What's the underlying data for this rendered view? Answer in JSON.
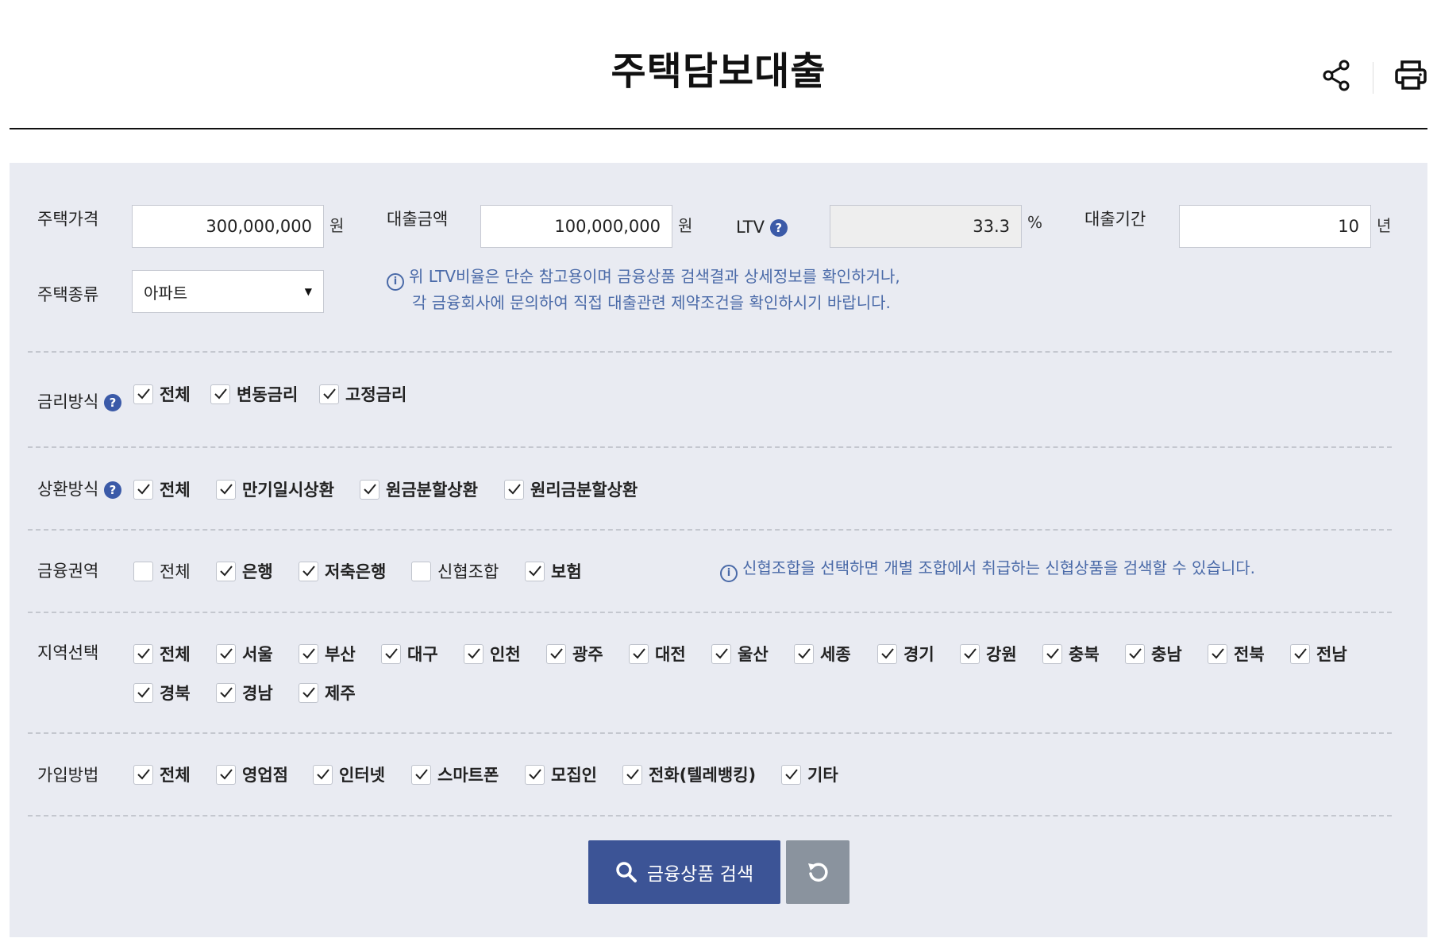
{
  "title": "주택담보대출",
  "inputs": {
    "house_price": {
      "label": "주택가격",
      "value": "300,000,000",
      "unit": "원"
    },
    "loan_amount": {
      "label": "대출금액",
      "value": "100,000,000",
      "unit": "원"
    },
    "ltv": {
      "label": "LTV",
      "value": "33.3",
      "unit": "%"
    },
    "loan_period": {
      "label": "대출기간",
      "value": "10",
      "unit": "년"
    },
    "house_type": {
      "label": "주택종류",
      "value": "아파트"
    }
  },
  "ltv_note": {
    "line1": "위 LTV비율은 단순 참고용이며 금융상품 검색결과 상세정보를 확인하거나,",
    "line2": "각 금융회사에 문의하여 직접 대출관련 제약조건을 확인하시기 바랍니다."
  },
  "rate_type": {
    "label": "금리방식",
    "options": [
      {
        "label": "전체",
        "checked": true
      },
      {
        "label": "변동금리",
        "checked": true
      },
      {
        "label": "고정금리",
        "checked": true
      }
    ]
  },
  "repay_type": {
    "label": "상환방식",
    "options": [
      {
        "label": "전체",
        "checked": true
      },
      {
        "label": "만기일시상환",
        "checked": true
      },
      {
        "label": "원금분할상환",
        "checked": true
      },
      {
        "label": "원리금분할상환",
        "checked": true
      }
    ]
  },
  "finance_sector": {
    "label": "금융권역",
    "options": [
      {
        "label": "전체",
        "checked": false
      },
      {
        "label": "은행",
        "checked": true
      },
      {
        "label": "저축은행",
        "checked": true
      },
      {
        "label": "신협조합",
        "checked": false
      },
      {
        "label": "보험",
        "checked": true
      }
    ],
    "note": "신협조합을 선택하면 개별 조합에서 취급하는 신협상품을 검색할 수 있습니다."
  },
  "region": {
    "label": "지역선택",
    "options": [
      {
        "label": "전체",
        "checked": true
      },
      {
        "label": "서울",
        "checked": true
      },
      {
        "label": "부산",
        "checked": true
      },
      {
        "label": "대구",
        "checked": true
      },
      {
        "label": "인천",
        "checked": true
      },
      {
        "label": "광주",
        "checked": true
      },
      {
        "label": "대전",
        "checked": true
      },
      {
        "label": "울산",
        "checked": true
      },
      {
        "label": "세종",
        "checked": true
      },
      {
        "label": "경기",
        "checked": true
      },
      {
        "label": "강원",
        "checked": true
      },
      {
        "label": "충북",
        "checked": true
      },
      {
        "label": "충남",
        "checked": true
      },
      {
        "label": "전북",
        "checked": true
      },
      {
        "label": "전남",
        "checked": true
      },
      {
        "label": "경북",
        "checked": true
      },
      {
        "label": "경남",
        "checked": true
      },
      {
        "label": "제주",
        "checked": true
      }
    ]
  },
  "join_method": {
    "label": "가입방법",
    "options": [
      {
        "label": "전체",
        "checked": true
      },
      {
        "label": "영업점",
        "checked": true
      },
      {
        "label": "인터넷",
        "checked": true
      },
      {
        "label": "스마트폰",
        "checked": true
      },
      {
        "label": "모집인",
        "checked": true
      },
      {
        "label": "전화(텔레뱅킹)",
        "checked": true
      },
      {
        "label": "기타",
        "checked": true
      }
    ]
  },
  "buttons": {
    "search": "금융상품 검색"
  },
  "colors": {
    "primary": "#3c5496",
    "panel": "#e9ebf2",
    "note": "#4a6aa8",
    "reset": "#8a939e"
  },
  "icons": {
    "share": "share-icon",
    "print": "print-icon",
    "help": "question-icon",
    "info": "info-icon",
    "search": "search-icon",
    "reset": "refresh-icon"
  }
}
